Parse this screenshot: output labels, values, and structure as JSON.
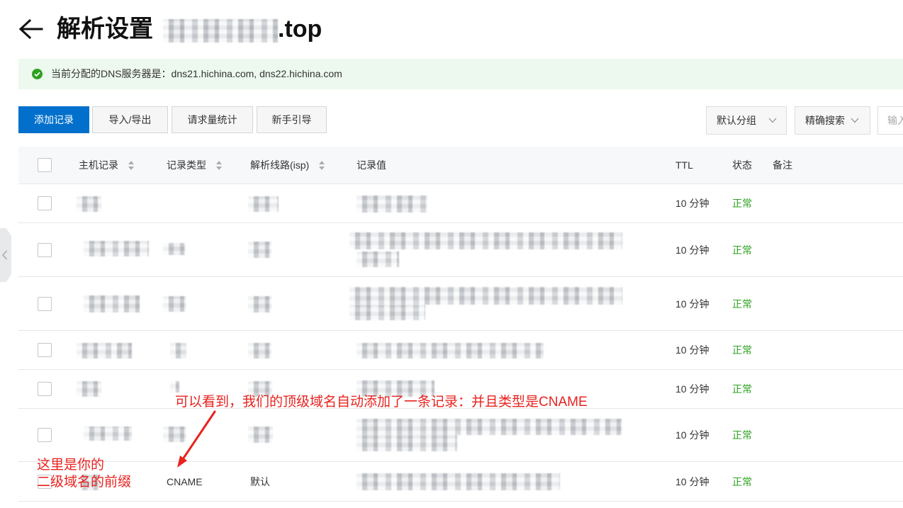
{
  "header": {
    "back_icon": "arrow-left-icon",
    "title": "解析设置",
    "domain_suffix": ".top"
  },
  "sidebar_toggle": {
    "icon": "chevron-left-icon"
  },
  "notice": {
    "icon": "check-circle-icon",
    "text": "当前分配的DNS服务器是：dns21.hichina.com, dns22.hichina.com"
  },
  "toolbar": {
    "add_record": "添加记录",
    "import_export": "导入/导出",
    "request_stats": "请求量统计",
    "beginner_guide": "新手引导",
    "group_select": {
      "value": "默认分组",
      "icon": "chevron-down-icon"
    },
    "search_mode_select": {
      "value": "精确搜索",
      "icon": "chevron-down-icon"
    },
    "search_input": {
      "placeholder": "输入"
    }
  },
  "table": {
    "columns": {
      "host": "主机记录",
      "type": "记录类型",
      "line": "解析线路(isp)",
      "value": "记录值",
      "ttl": "TTL",
      "status": "状态",
      "remark": "备注"
    },
    "sort_icon": "sort-icon",
    "rows": [
      {
        "ttl": "10 分钟",
        "status": "正常"
      },
      {
        "ttl": "10 分钟",
        "status": "正常"
      },
      {
        "ttl": "10 分钟",
        "status": "正常"
      },
      {
        "ttl": "10 分钟",
        "status": "正常"
      },
      {
        "ttl": "10 分钟",
        "status": "正常"
      },
      {
        "ttl": "10 分钟",
        "status": "正常"
      },
      {
        "type": "CNAME",
        "line": "默认",
        "ttl": "10 分钟",
        "status": "正常"
      }
    ]
  },
  "annotations": {
    "top_note": "可以看到，我们的顶级域名自动添加了一条记录：并且类型是CNAME",
    "left_note_line1": "这里是你的",
    "left_note_line2": "二级域名的前缀"
  },
  "colors": {
    "primary": "#0070cc",
    "success": "#2ea121",
    "notice_bg": "#edf8ee",
    "annotation": "#e8231f"
  }
}
